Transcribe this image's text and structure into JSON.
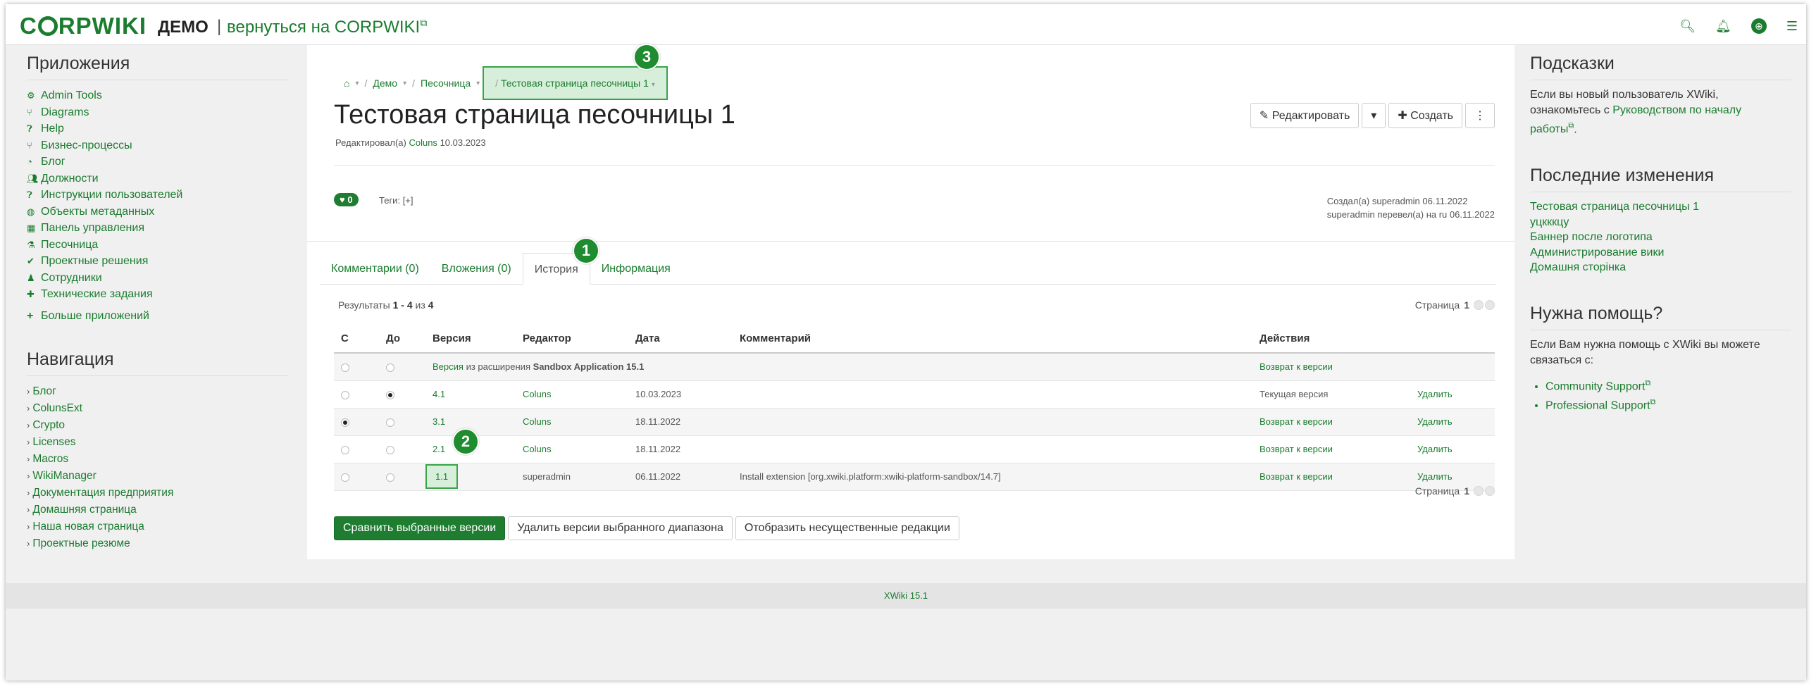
{
  "header": {
    "logo": "CORPWIKI",
    "wiki_name": "ДЕМО",
    "separator": "|",
    "back_link": "вернуться на CORPWIKI",
    "icons": [
      "search-icon",
      "bell-icon",
      "globe-icon",
      "menu-icon"
    ]
  },
  "apps": {
    "title": "Приложения",
    "items": [
      {
        "icon": "wrench-icon",
        "label": "Admin Tools"
      },
      {
        "icon": "diagram-icon",
        "label": "Diagrams"
      },
      {
        "icon": "question-icon",
        "label": "Help"
      },
      {
        "icon": "process-icon",
        "label": "Бизнес-процессы"
      },
      {
        "icon": "rss-icon",
        "label": "Блог"
      },
      {
        "icon": "users-icon",
        "label": "Должности"
      },
      {
        "icon": "question-icon",
        "label": "Инструкции пользователей"
      },
      {
        "icon": "globe-icon",
        "label": "Объекты метаданных"
      },
      {
        "icon": "dashboard-icon",
        "label": "Панель управления"
      },
      {
        "icon": "sandbox-icon",
        "label": "Песочница"
      },
      {
        "icon": "check-icon",
        "label": "Проектные решения"
      },
      {
        "icon": "person-icon",
        "label": "Сотрудники"
      },
      {
        "icon": "plus-icon",
        "label": "Технические задания"
      }
    ],
    "more": "Больше приложений"
  },
  "navigation": {
    "title": "Навигация",
    "items": [
      "Блог",
      "ColunsExt",
      "Crypto",
      "Licenses",
      "Macros",
      "WikiManager",
      "Документация предприятия",
      "Домашняя страница",
      "Наша новая страница",
      "Проектные резюме"
    ]
  },
  "breadcrumb": {
    "home": "⌂",
    "items": [
      "Демо",
      "Песочница",
      "Тестовая страница песочницы 1"
    ],
    "separator": "/"
  },
  "page": {
    "title": "Тестовая страница песочницы 1",
    "edited_prefix": "Редактировал(а)",
    "edited_user": "Coluns",
    "edited_date": "10.03.2023",
    "edit_button": "Редактировать",
    "create_button": "Создать",
    "like_count": "0",
    "tags_label": "Теги:",
    "tags_add": "[+]",
    "created_line": "Создал(а) superadmin 06.11.2022",
    "translated_line": "superadmin перевел(а) на ru 06.11.2022"
  },
  "tabs": [
    {
      "label": "Комментарии (0)",
      "active": false
    },
    {
      "label": "Вложения (0)",
      "active": false
    },
    {
      "label": "История",
      "active": true
    },
    {
      "label": "Информация",
      "active": false
    }
  ],
  "history": {
    "results_prefix": "Результаты",
    "results_range": "1 - 4",
    "results_of": "из",
    "results_total": "4",
    "page_label": "Страница",
    "page_number": "1",
    "columns": [
      "С",
      "До",
      "Версия",
      "Редактор",
      "Дата",
      "Комментарий",
      "Действия"
    ],
    "extension_row": {
      "version_link": "Версия",
      "text": "из расширения",
      "bold": "Sandbox Application 15.1",
      "action": "Возврат к версии"
    },
    "rows": [
      {
        "version": "4.1",
        "editor": "Coluns",
        "date": "10.03.2023",
        "comment": "",
        "action": "Текущая версия",
        "delete": "Удалить",
        "from": false,
        "to": true
      },
      {
        "version": "3.1",
        "editor": "Coluns",
        "date": "18.11.2022",
        "comment": "",
        "action": "Возврат к версии",
        "delete": "Удалить",
        "from": true,
        "to": false
      },
      {
        "version": "2.1",
        "editor": "Coluns",
        "date": "18.11.2022",
        "comment": "",
        "action": "Возврат к версии",
        "delete": "Удалить",
        "from": false,
        "to": false
      },
      {
        "version": "1.1",
        "editor": "superadmin",
        "date": "06.11.2022",
        "comment": "Install extension [org.xwiki.platform:xwiki-platform-sandbox/14.7]",
        "action": "Возврат к версии",
        "delete": "Удалить",
        "from": false,
        "to": false
      }
    ],
    "buttons": {
      "compare": "Сравнить выбранные версии",
      "delete_range": "Удалить версии выбранного диапазона",
      "show_minor": "Отобразить несущественные редакции"
    }
  },
  "callouts": [
    "1",
    "2",
    "3"
  ],
  "right": {
    "tips_title": "Подсказки",
    "tips_text": "Если вы новый пользователь XWiki, ознакомьтесь с",
    "tips_link": "Руководством по началу работы",
    "tips_end": ".",
    "changes_title": "Последние изменения",
    "changes": [
      "Тестовая страница песочницы 1",
      "уцкккцу",
      "Баннер после логотипа",
      "Администрирование вики",
      "Домашня сторінка"
    ],
    "help_title": "Нужна помощь?",
    "help_text": "Если Вам нужна помощь с XWiki вы можете связаться с:",
    "help_links": [
      "Community Support",
      "Professional Support"
    ]
  },
  "footer": "XWiki 15.1",
  "colors": {
    "brand": "#1a7c2e",
    "callout": "#1e8c2f",
    "highlight": "#d7efda"
  }
}
